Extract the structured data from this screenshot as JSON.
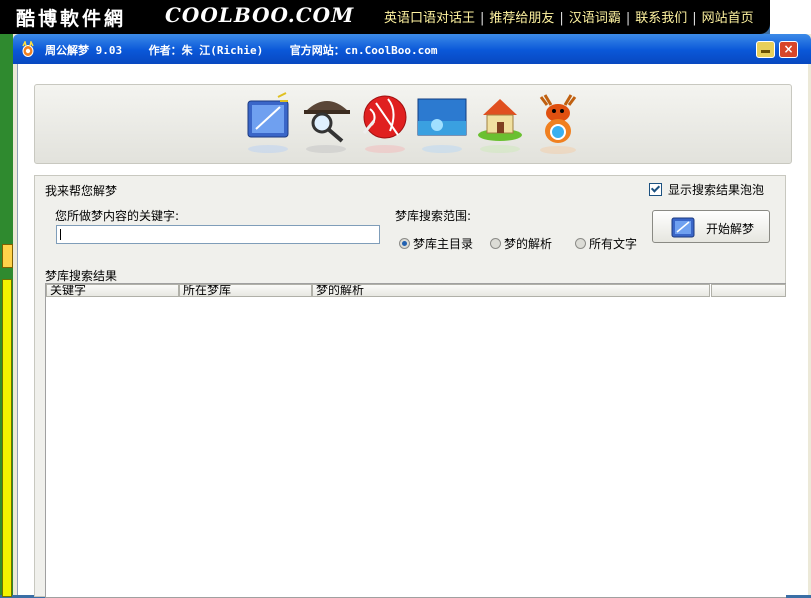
{
  "banner": {
    "brand_cn": "酷博軟件網",
    "brand_en": "COOLBOO.COM",
    "links": [
      "英语口语对话王",
      "推荐给朋友",
      "汉语词霸",
      "联系我们",
      "网站首页"
    ]
  },
  "window": {
    "app_name": "周公解梦 9.03",
    "author": "作者：朱 江(Richie)",
    "website": "官方网站：cn.CoolBoo.com",
    "close_glyph": "×"
  },
  "toolbar": {
    "tools": [
      "dream-book-icon",
      "detective-icon",
      "globe-icon",
      "landscape-icon",
      "cottage-icon",
      "moose-icon"
    ]
  },
  "form": {
    "group_label": "我来帮您解梦",
    "show_bubble_label": "显示搜索结果泡泡",
    "show_bubble_checked": true,
    "keyword_label": "您所做梦内容的关键字:",
    "keyword_value": "",
    "scope_label": "梦库搜索范围:",
    "scope_options": [
      "梦库主目录",
      "梦的解析",
      "所有文字"
    ],
    "scope_selected": "梦库主目录",
    "start_button": "开始解梦"
  },
  "results": {
    "label": "梦库搜索结果",
    "columns": [
      "关键字",
      "所在梦库",
      "梦的解析",
      ""
    ]
  },
  "colors": {
    "title_blue": "#0a57d8",
    "banner_link": "#fff3a0",
    "accent_green": "#2f8a2f"
  }
}
